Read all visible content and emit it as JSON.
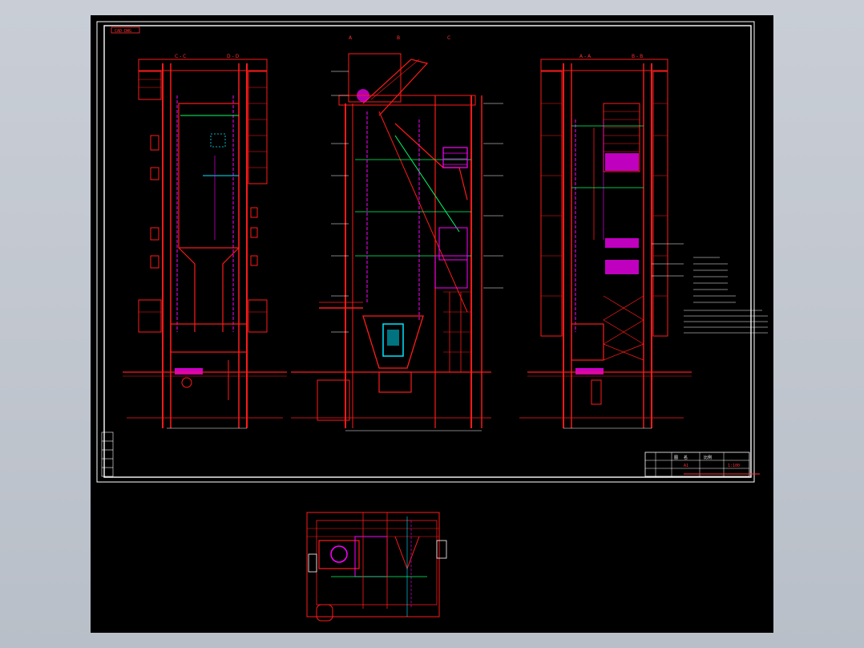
{
  "window": {
    "background": "#c3c8d0"
  },
  "sheet": {
    "tag": "CAD-DWG"
  },
  "colors": {
    "canvas": "#000000",
    "frame": "#ffffff",
    "structure": "#ff1a1a",
    "magenta": "#ff00ff",
    "green": "#00ff66",
    "cyan": "#00e5ff",
    "yellow": "#ffff00",
    "blue": "#4060ff",
    "white": "#ffffff"
  },
  "views": {
    "left": {
      "marks": [
        "C - C",
        "D - D"
      ]
    },
    "center": {
      "marks": [
        "A",
        "B",
        "C"
      ]
    },
    "right": {
      "marks": [
        "A - A",
        "B - B"
      ]
    }
  },
  "title_block": {
    "row1": [
      "图",
      "名",
      "比例"
    ],
    "row2": [
      "A1",
      "1:100"
    ]
  }
}
